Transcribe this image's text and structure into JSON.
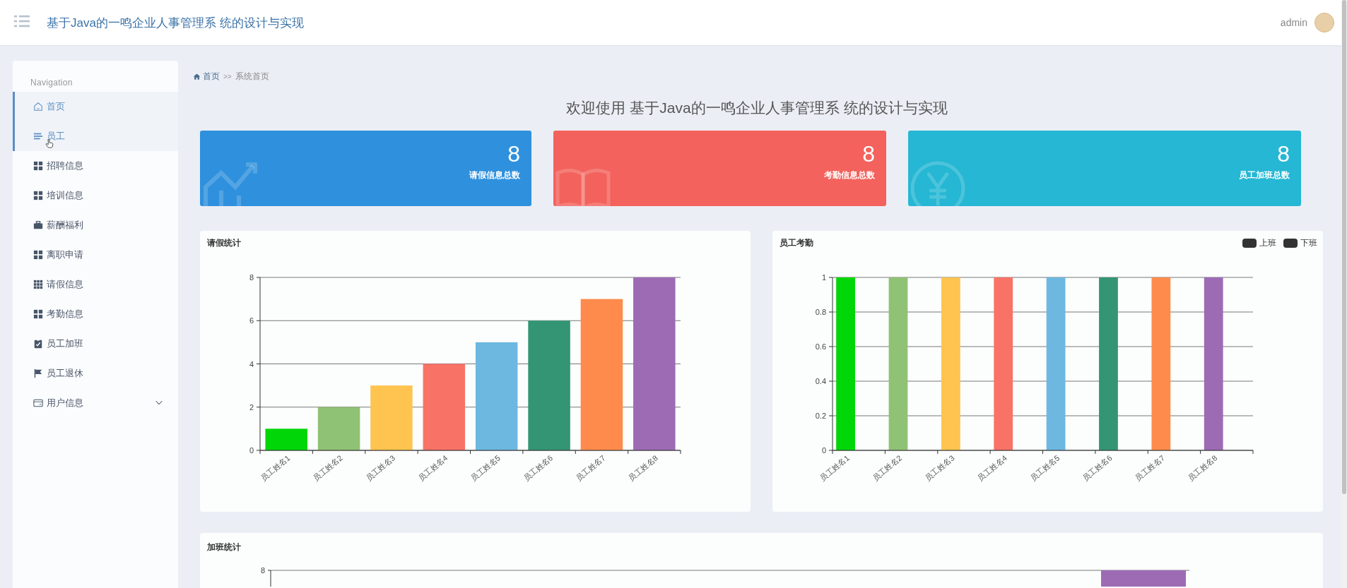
{
  "header": {
    "title": "基于Java的一鸣企业人事管理系 统的设计与实现",
    "user": "admin"
  },
  "sidebar": {
    "heading": "Navigation",
    "items": [
      {
        "label": "首页",
        "selected": true,
        "hovered": false
      },
      {
        "label": "员工",
        "selected": true,
        "hovered": true
      },
      {
        "label": "招聘信息",
        "selected": false,
        "hovered": false
      },
      {
        "label": "培训信息",
        "selected": false,
        "hovered": false
      },
      {
        "label": "薪酬福利",
        "selected": false,
        "hovered": false
      },
      {
        "label": "离职申请",
        "selected": false,
        "hovered": false
      },
      {
        "label": "请假信息",
        "selected": false,
        "hovered": false
      },
      {
        "label": "考勤信息",
        "selected": false,
        "hovered": false
      },
      {
        "label": "员工加班",
        "selected": false,
        "hovered": false
      },
      {
        "label": "员工退休",
        "selected": false,
        "hovered": false
      },
      {
        "label": "用户信息",
        "selected": false,
        "hovered": false,
        "expanded": false
      }
    ]
  },
  "breadcrumb": {
    "home": "首页",
    "separator": ">>",
    "current": "系统首页"
  },
  "welcome": "欢迎使用 基于Java的一鸣企业人事管理系 统的设计与实现",
  "stat_cards": [
    {
      "value": "8",
      "label": "请假信息总数",
      "color": "#2f91dd"
    },
    {
      "value": "8",
      "label": "考勤信息总数",
      "color": "#f3625c"
    },
    {
      "value": "8",
      "label": "员工加班总数",
      "color": "#25b7d3"
    }
  ],
  "charts": [
    {
      "title": "请假统计",
      "chart_data": {
        "type": "bar",
        "grid": true,
        "categories": [
          "员工姓名1",
          "员工姓名2",
          "员工姓名3",
          "员工姓名4",
          "员工姓名5",
          "员工姓名6",
          "员工姓名7",
          "员工姓名8"
        ],
        "colors": [
          "#00d608",
          "#8fc274",
          "#fec44f",
          "#f87366",
          "#6cb8e0",
          "#339573",
          "#fe8b4b",
          "#9d6bb4"
        ],
        "values": [
          1,
          2,
          3,
          4,
          5,
          6,
          7,
          8
        ],
        "ylim": [
          0,
          8
        ],
        "yticks": [
          0,
          2,
          4,
          6,
          8
        ]
      }
    },
    {
      "title": "员工考勤",
      "legend": [
        {
          "label": "上班",
          "color": "#333333"
        },
        {
          "label": "下班",
          "color": "#333333"
        }
      ],
      "chart_data": {
        "type": "bar",
        "grid": true,
        "categories": [
          "员工姓名1",
          "员工姓名2",
          "员工姓名3",
          "员工姓名4",
          "员工姓名5",
          "员工姓名6",
          "员工姓名7",
          "员工姓名8"
        ],
        "colors": [
          "#00d608",
          "#8fc274",
          "#fec44f",
          "#f87366",
          "#6cb8e0",
          "#339573",
          "#fe8b4b",
          "#9d6bb4"
        ],
        "values": [
          1,
          1,
          1,
          1,
          1,
          1,
          1,
          1
        ],
        "ylim": [
          0,
          1
        ],
        "yticks": [
          {
            "value": 0,
            "label": "0"
          },
          {
            "value": 0.2,
            "label": "0.2"
          },
          {
            "value": 0.4,
            "label": "0.4"
          },
          {
            "value": 0.6,
            "label": "0.6"
          },
          {
            "value": 0.8,
            "label": "0.8"
          },
          {
            "value": 1,
            "label": "1"
          }
        ]
      }
    }
  ],
  "overtime": {
    "title": "加班统计",
    "top_tick": "8"
  }
}
